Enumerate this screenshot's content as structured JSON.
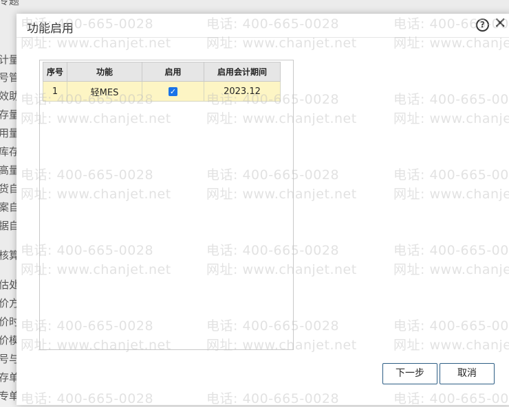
{
  "background": {
    "items": [
      "专题",
      "计量",
      "号管",
      "效助",
      "存量",
      "用量",
      "库存",
      "高量",
      "货自",
      "案自",
      "据自",
      "核算",
      "估处",
      "价方",
      "价时",
      "价模",
      "号与",
      "存单",
      "专单"
    ]
  },
  "dialog": {
    "title": "功能启用",
    "help_icon": "help-circle-icon",
    "close_icon": "close-icon",
    "next_label": "下一步",
    "cancel_label": "取消"
  },
  "grid": {
    "headers": [
      "序号",
      "功能",
      "启用",
      "启用会计期间"
    ],
    "rows": [
      {
        "index": "1",
        "feature": "轻MES",
        "enabled": true,
        "period": "2023.12"
      }
    ]
  },
  "watermark": {
    "phone": "电话: 400-665-0028",
    "site": "网址: www.chanjet.net"
  },
  "colors": {
    "row_highlight": "#fdf5c4",
    "header_bg": "#e6e6e6",
    "button_border": "#2c5d84",
    "checkbox": "#1a73e8"
  }
}
